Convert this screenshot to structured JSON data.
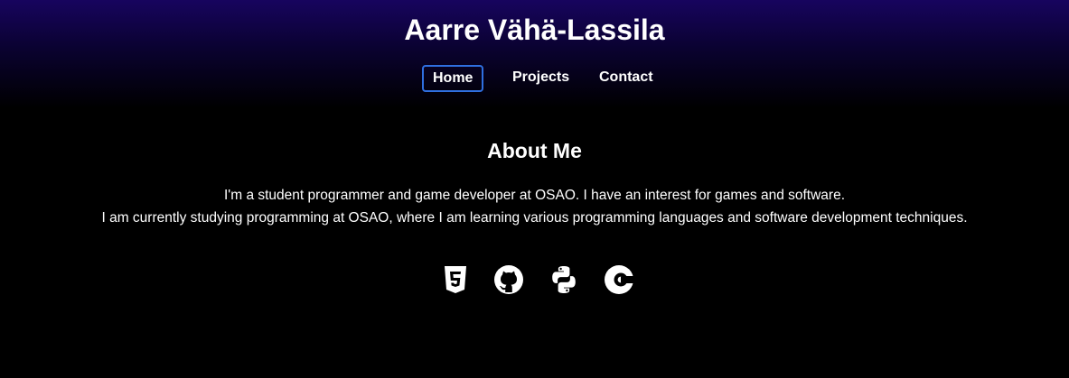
{
  "header": {
    "title": "Aarre Vähä-Lassila",
    "nav": [
      {
        "label": "Home",
        "active": true
      },
      {
        "label": "Projects",
        "active": false
      },
      {
        "label": "Contact",
        "active": false
      }
    ],
    "accent_color": "#2f6fe0",
    "gradient_top_color": "#17045e"
  },
  "about": {
    "heading": "About Me",
    "line1": "I'm a student programmer and game developer at OSAO. I have an interest for games and software.",
    "line2": "I am currently studying programming at OSAO, where I am learning various programming languages and software development techniques."
  },
  "skills": {
    "icons": [
      "html5-icon",
      "github-icon",
      "python-icon",
      "c-language-icon"
    ]
  }
}
